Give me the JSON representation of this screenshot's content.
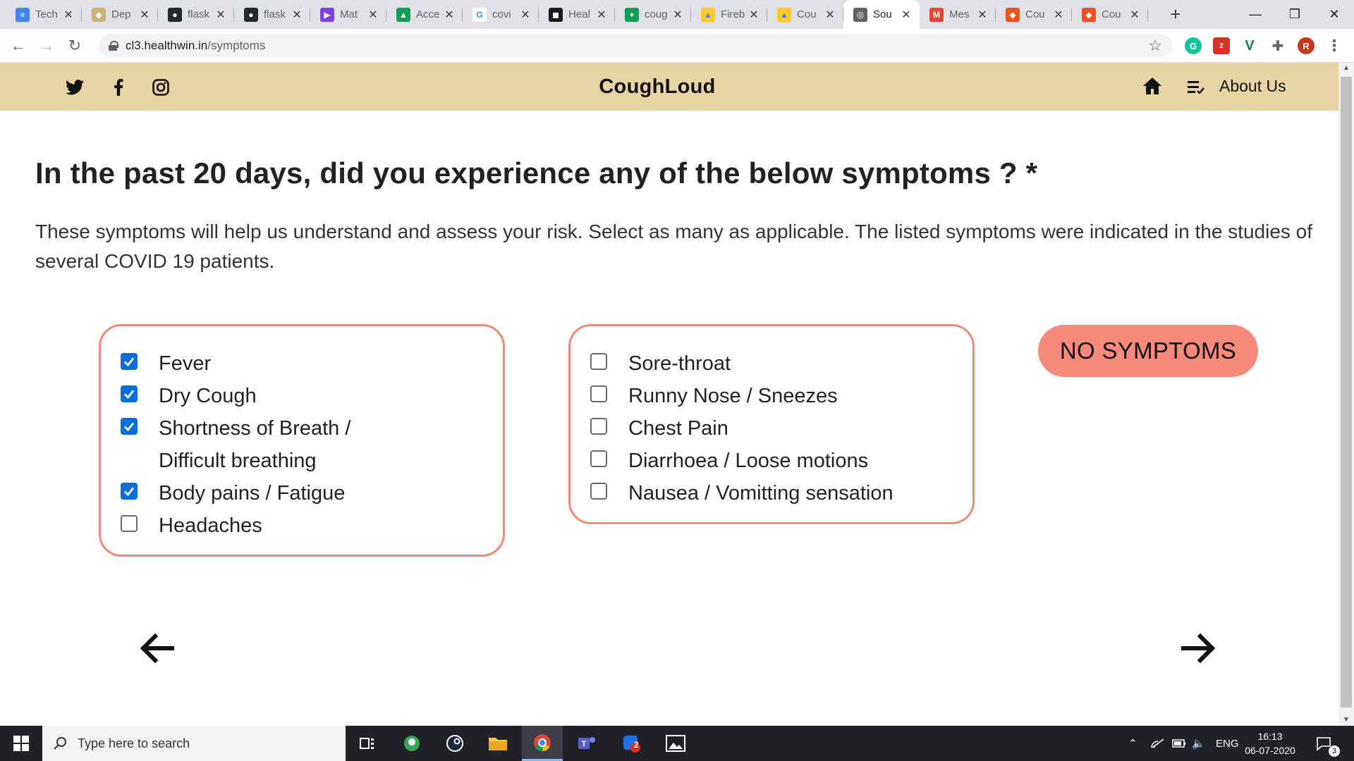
{
  "browser": {
    "tabs": [
      {
        "title": "Tech",
        "favicon_color": "#4285f4",
        "favicon_glyph": "≡",
        "icon": "docs-icon"
      },
      {
        "title": "Dep",
        "favicon_color": "#c9b27c",
        "favicon_glyph": "◆",
        "icon": "deploy-icon"
      },
      {
        "title": "flask",
        "favicon_color": "#24292e",
        "favicon_glyph": "●",
        "icon": "github-icon"
      },
      {
        "title": "flask",
        "favicon_color": "#24292e",
        "favicon_glyph": "●",
        "icon": "github-icon"
      },
      {
        "title": "Mat",
        "favicon_color": "#7b3fe4",
        "favicon_glyph": "▶",
        "icon": "play-icon"
      },
      {
        "title": "Acce",
        "favicon_color": "#0f9d58",
        "favicon_glyph": "▲",
        "icon": "drive-icon"
      },
      {
        "title": "covi",
        "favicon_color": "#ffffff",
        "favicon_glyph": "G",
        "icon": "google-icon"
      },
      {
        "title": "Heal",
        "favicon_color": "#1b1b1b",
        "favicon_glyph": "◼",
        "icon": "health-icon"
      },
      {
        "title": "coug",
        "favicon_color": "#0f9d58",
        "favicon_glyph": "+",
        "icon": "sheets-icon"
      },
      {
        "title": "Fireb",
        "favicon_color": "#ffca28",
        "favicon_glyph": "▲",
        "icon": "firebase-icon"
      },
      {
        "title": "Cou",
        "favicon_color": "#ffca28",
        "favicon_glyph": "▲",
        "icon": "firebase-icon"
      },
      {
        "title": "Sou",
        "favicon_color": "#5f6368",
        "favicon_glyph": "◎",
        "icon": "globe-icon",
        "active": true
      },
      {
        "title": "Mes",
        "favicon_color": "#ea4335",
        "favicon_glyph": "M",
        "icon": "gmail-icon"
      },
      {
        "title": "Cou",
        "favicon_color": "#f24e1e",
        "favicon_glyph": "◆",
        "icon": "figma-icon"
      },
      {
        "title": "Cou",
        "favicon_color": "#f24e1e",
        "favicon_glyph": "◆",
        "icon": "figma-icon"
      }
    ],
    "url_host": "cl3.healthwin.in",
    "url_path": "/symptoms",
    "profile_initial": "R",
    "ext_badge": "2"
  },
  "site": {
    "brand": "CoughLoud",
    "about_label": "About Us"
  },
  "question": {
    "title": "In the past 20 days, did you experience any of the below symptoms ? *",
    "description": "These symptoms will help us understand and assess your risk. Select as many as applicable. The listed symptoms were indicated in the studies of several COVID 19 patients."
  },
  "symptoms_left": [
    {
      "label": "Fever",
      "checked": true
    },
    {
      "label": "Dry Cough",
      "checked": true
    },
    {
      "label": "Shortness of Breath /",
      "label2": "Difficult breathing",
      "checked": true
    },
    {
      "label": "Body pains / Fatigue",
      "checked": true
    },
    {
      "label": "Headaches",
      "checked": false
    }
  ],
  "symptoms_right": [
    {
      "label": "Sore-throat",
      "checked": false
    },
    {
      "label": "Runny Nose / Sneezes",
      "checked": false
    },
    {
      "label": "Chest Pain",
      "checked": false
    },
    {
      "label": "Diarrhoea / Loose motions",
      "checked": false
    },
    {
      "label": "Nausea / Vomitting sensation",
      "checked": false
    }
  ],
  "no_symptoms_label": "NO SYMPTOMS",
  "taskbar": {
    "search_placeholder": "Type here to search",
    "language": "ENG",
    "time": "16:13",
    "date": "06-07-2020",
    "notification_count": "3",
    "app_badge": "2"
  },
  "colors": {
    "header_bg": "#e8d4a2",
    "accent": "#f88a7c",
    "box_border": "#f08878",
    "checkbox_checked": "#0b6dd8"
  }
}
